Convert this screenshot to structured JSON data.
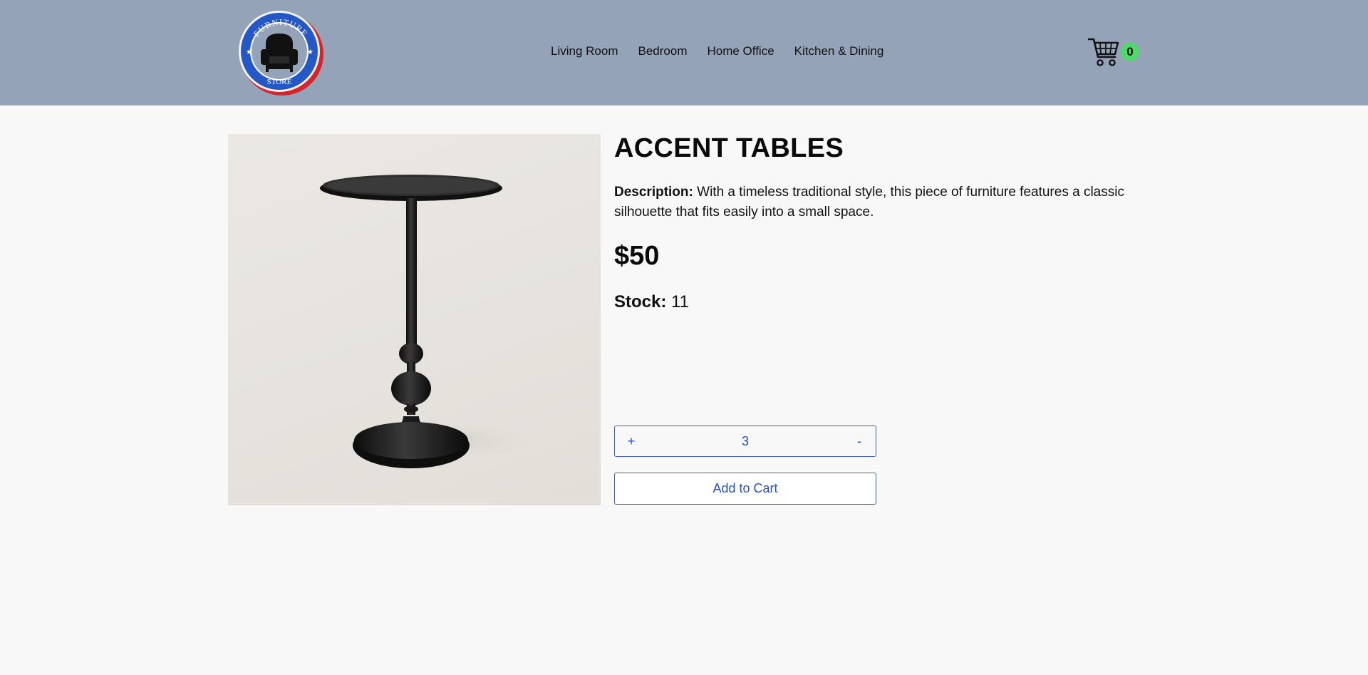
{
  "header": {
    "logo": {
      "top_text": "FURNITURE",
      "bottom_text": "STORE",
      "icon": "armchair-icon"
    },
    "nav": [
      "Living Room",
      "Bedroom",
      "Home Office",
      "Kitchen & Dining"
    ],
    "cart": {
      "icon": "shopping-cart-icon",
      "count": "0"
    }
  },
  "product": {
    "title": "ACCENT TABLES",
    "description_label": "Description:",
    "description": "With a timeless traditional style, this piece of furniture features a classic silhouette that fits easily into a small space.",
    "price": "$50",
    "stock_label": "Stock:",
    "stock": "11",
    "quantity": {
      "increment_label": "+",
      "value": "3",
      "decrement_label": "-"
    },
    "add_to_cart_label": "Add to Cart"
  },
  "colors": {
    "header_bg": "#95a3b9",
    "page_bg": "#f8f8f8",
    "accent_blue": "#2b4fc4",
    "badge_green": "#4fd96a"
  }
}
